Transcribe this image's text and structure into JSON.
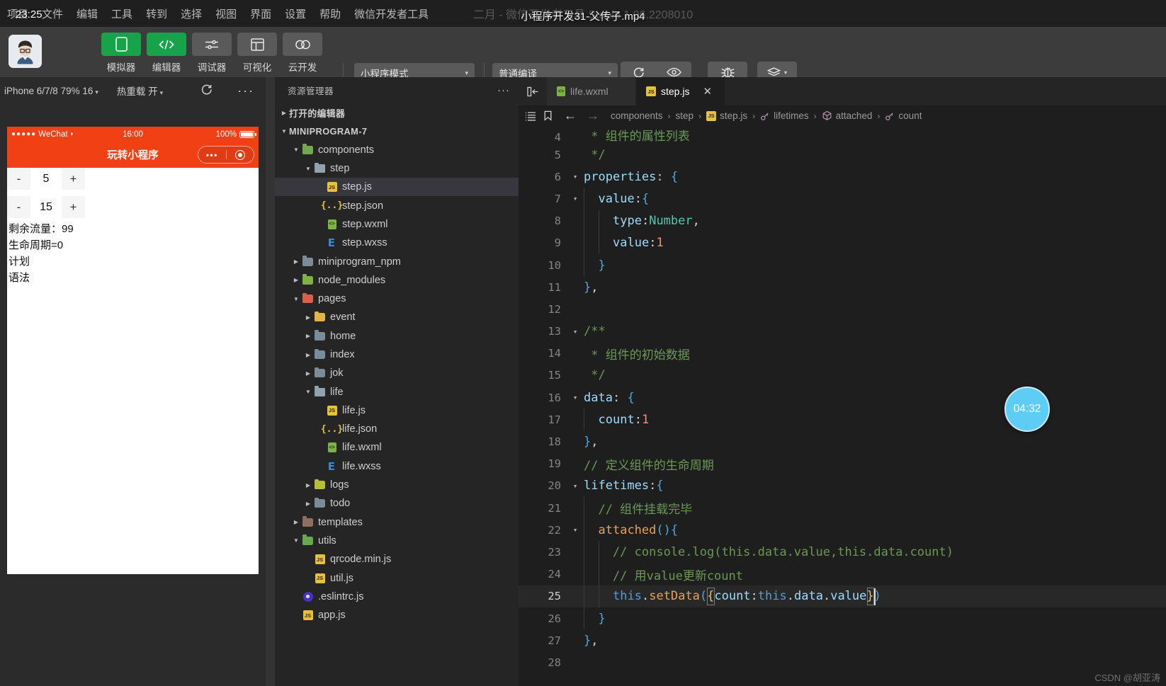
{
  "window": {
    "clock": "23:25",
    "faint_title": "二月 - 微信开发者工具 Stable 1.06.2208010",
    "video_overlay_title": "小程序开发31-父传子.mp4"
  },
  "menubar": {
    "items": [
      "项目",
      "文件",
      "编辑",
      "工具",
      "转到",
      "选择",
      "视图",
      "界面",
      "设置",
      "帮助",
      "微信开发者工具"
    ]
  },
  "toolbar": {
    "left_buttons": [
      {
        "label": "模拟器",
        "icon": "phone-icon",
        "active": true
      },
      {
        "label": "编辑器",
        "icon": "code-icon",
        "active": true
      },
      {
        "label": "调试器",
        "icon": "sliders-icon",
        "active": false
      },
      {
        "label": "可视化",
        "icon": "layout-icon",
        "active": false
      },
      {
        "label": "云开发",
        "icon": "cloud-icon",
        "active": false
      }
    ],
    "mode_select": {
      "value": "小程序模式",
      "caret": "▾"
    },
    "compile_select": {
      "value": "普通编译",
      "caret": "▾"
    },
    "right_buttons": [
      {
        "label": "编译",
        "icon": "refresh-icon"
      },
      {
        "label": "预览",
        "icon": "eye-icon"
      },
      {
        "label": "真机调试",
        "icon": "bug-icon"
      },
      {
        "label": "清缓存",
        "icon": "layers-icon",
        "caret": "▾"
      }
    ]
  },
  "simulator": {
    "device_select": "iPhone 6/7/8 79% 16",
    "hotreload_select": "热重载 开",
    "refresh_icon": "refresh-icon",
    "more_icon": "ellipsis-icon",
    "phone": {
      "carrier": "WeChat",
      "signal_dots": "●●●●●",
      "wifi": "⌃",
      "time": "16:00",
      "battery_pct": "100%",
      "nav_title": "玩转小程序",
      "steppers": [
        {
          "minus": "-",
          "value": "5",
          "plus": "+"
        },
        {
          "minus": "-",
          "value": "15",
          "plus": "+"
        }
      ],
      "lines": [
        "剩余流量：99",
        "生命周期=0",
        "计划",
        "语法"
      ]
    }
  },
  "explorer": {
    "title": "资源管理器",
    "more_icon": "ellipsis-icon",
    "tree": [
      {
        "label": "打开的编辑器",
        "depth": 0,
        "twisty": "collapsed",
        "icon": "none",
        "bold": true
      },
      {
        "label": "MINIPROGRAM-7",
        "depth": 0,
        "twisty": "expanded",
        "icon": "none",
        "bold": true
      },
      {
        "label": "components",
        "depth": 1,
        "twisty": "expanded",
        "icon": "folder-green"
      },
      {
        "label": "step",
        "depth": 2,
        "twisty": "expanded",
        "icon": "folder-open-gray"
      },
      {
        "label": "step.js",
        "depth": 3,
        "twisty": "none",
        "icon": "js",
        "selected": true
      },
      {
        "label": "step.json",
        "depth": 3,
        "twisty": "none",
        "icon": "json"
      },
      {
        "label": "step.wxml",
        "depth": 3,
        "twisty": "none",
        "icon": "wxml"
      },
      {
        "label": "step.wxss",
        "depth": 3,
        "twisty": "none",
        "icon": "wxss"
      },
      {
        "label": "miniprogram_npm",
        "depth": 1,
        "twisty": "collapsed",
        "icon": "folder-gray"
      },
      {
        "label": "node_modules",
        "depth": 1,
        "twisty": "collapsed",
        "icon": "folder-node"
      },
      {
        "label": "pages",
        "depth": 1,
        "twisty": "expanded",
        "icon": "folder-red"
      },
      {
        "label": "event",
        "depth": 2,
        "twisty": "collapsed",
        "icon": "folder-yellow"
      },
      {
        "label": "home",
        "depth": 2,
        "twisty": "collapsed",
        "icon": "folder-gray"
      },
      {
        "label": "index",
        "depth": 2,
        "twisty": "collapsed",
        "icon": "folder-gray"
      },
      {
        "label": "jok",
        "depth": 2,
        "twisty": "collapsed",
        "icon": "folder-gray"
      },
      {
        "label": "life",
        "depth": 2,
        "twisty": "expanded",
        "icon": "folder-open-gray"
      },
      {
        "label": "life.js",
        "depth": 3,
        "twisty": "none",
        "icon": "js"
      },
      {
        "label": "life.json",
        "depth": 3,
        "twisty": "none",
        "icon": "json"
      },
      {
        "label": "life.wxml",
        "depth": 3,
        "twisty": "none",
        "icon": "wxml"
      },
      {
        "label": "life.wxss",
        "depth": 3,
        "twisty": "none",
        "icon": "wxss"
      },
      {
        "label": "logs",
        "depth": 2,
        "twisty": "collapsed",
        "icon": "folder-logs"
      },
      {
        "label": "todo",
        "depth": 2,
        "twisty": "collapsed",
        "icon": "folder-gray"
      },
      {
        "label": "templates",
        "depth": 1,
        "twisty": "collapsed",
        "icon": "folder-brown"
      },
      {
        "label": "utils",
        "depth": 1,
        "twisty": "expanded",
        "icon": "folder-green2"
      },
      {
        "label": "qrcode.min.js",
        "depth": 2,
        "twisty": "none",
        "icon": "js"
      },
      {
        "label": "util.js",
        "depth": 2,
        "twisty": "none",
        "icon": "js"
      },
      {
        "label": ".eslintrc.js",
        "depth": 1,
        "twisty": "none",
        "icon": "eslint"
      },
      {
        "label": "app.js",
        "depth": 1,
        "twisty": "none",
        "icon": "js"
      }
    ]
  },
  "editor": {
    "split_icon": "split-editor-icon",
    "tabs": [
      {
        "label": "life.wxml",
        "icon": "wxml",
        "active": false,
        "closable": false
      },
      {
        "label": "step.js",
        "icon": "js",
        "active": true,
        "closable": true,
        "close": "✕"
      }
    ],
    "breadcrumb": {
      "left_icons": [
        "outline-icon",
        "bookmark-icon",
        "back-arrow-icon",
        "forward-arrow-icon"
      ],
      "parts": [
        {
          "text": "components",
          "icon": "none"
        },
        {
          "text": "step",
          "icon": "none"
        },
        {
          "text": "step.js",
          "icon": "js"
        },
        {
          "text": "lifetimes",
          "icon": "property-icon"
        },
        {
          "text": "attached",
          "icon": "method-icon"
        },
        {
          "text": "count",
          "icon": "property-icon"
        }
      ],
      "separator": "›"
    },
    "current_line": 25,
    "lines": [
      {
        "no": 4,
        "fold": "",
        "text": " * 组件的属性列表",
        "clipped_top": true
      },
      {
        "no": 5,
        "fold": "",
        "text": " */"
      },
      {
        "no": 6,
        "fold": "▾",
        "text": "properties: {"
      },
      {
        "no": 7,
        "fold": "▾",
        "text": "  value:{"
      },
      {
        "no": 8,
        "fold": "",
        "text": "    type:Number,"
      },
      {
        "no": 9,
        "fold": "",
        "text": "    value:1"
      },
      {
        "no": 10,
        "fold": "",
        "text": "  }"
      },
      {
        "no": 11,
        "fold": "",
        "text": "},"
      },
      {
        "no": 12,
        "fold": "",
        "text": ""
      },
      {
        "no": 13,
        "fold": "▾",
        "text": "/**"
      },
      {
        "no": 14,
        "fold": "",
        "text": " * 组件的初始数据"
      },
      {
        "no": 15,
        "fold": "",
        "text": " */"
      },
      {
        "no": 16,
        "fold": "▾",
        "text": "data: {"
      },
      {
        "no": 17,
        "fold": "",
        "text": "  count:1"
      },
      {
        "no": 18,
        "fold": "",
        "text": "},"
      },
      {
        "no": 19,
        "fold": "",
        "text": "// 定义组件的生命周期"
      },
      {
        "no": 20,
        "fold": "▾",
        "text": "lifetimes:{"
      },
      {
        "no": 21,
        "fold": "",
        "text": "  // 组件挂载完毕"
      },
      {
        "no": 22,
        "fold": "▾",
        "text": "  attached(){"
      },
      {
        "no": 23,
        "fold": "",
        "text": "    // console.log(this.data.value,this.data.count)"
      },
      {
        "no": 24,
        "fold": "",
        "text": "    // 用value更新count"
      },
      {
        "no": 25,
        "fold": "",
        "text": "    this.setData({count:this.data.value})"
      },
      {
        "no": 26,
        "fold": "",
        "text": "  }"
      },
      {
        "no": 27,
        "fold": "",
        "text": "},"
      },
      {
        "no": 28,
        "fold": "",
        "text": ""
      }
    ]
  },
  "overlays": {
    "timer_bubble": "04:32",
    "watermark": "CSDN @胡亚涛"
  },
  "colors": {
    "accent_green": "#16a34a",
    "wechat_red": "#f24015",
    "editor_bg": "#1e1e1e",
    "sidebar_bg": "#252526",
    "toolbar_bg": "#3c3c3c",
    "timer_blue": "#5ecdf5"
  }
}
